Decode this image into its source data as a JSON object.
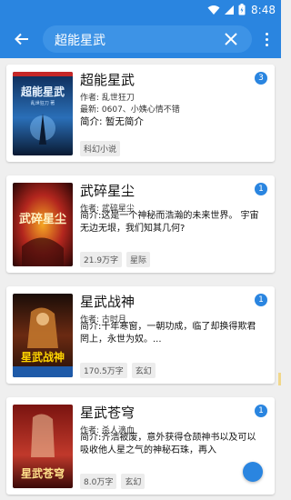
{
  "status_bar": {
    "time": "8:48",
    "icons": [
      "wifi-icon",
      "signal-icon",
      "battery-icon"
    ]
  },
  "app_bar": {
    "search_value": "超能星武",
    "icons": [
      "back-arrow-icon",
      "clear-icon",
      "more-vert-icon"
    ]
  },
  "colors": {
    "primary": "#2a85e0",
    "tag_bg": "#ececec",
    "background": "#efefef"
  },
  "results": [
    {
      "title": "超能星武",
      "author": "作者: 乱世狂刀",
      "latest": "最新: 0607、小姨心情不错",
      "intro": "简介: 暂无简介",
      "tags": [
        "科幻小说"
      ],
      "badge": "3",
      "cover_text": "超能星武",
      "cover_sub": "乱世狂刀 著"
    },
    {
      "title": "武碎星尘",
      "author": "作者: 武碎星尘",
      "intro": "简介:这是一个神秘而浩瀚的未来世界。 宇宙无边无垠，我们知其几何?",
      "tags": [
        "21.9万字",
        "星际"
      ],
      "badge": "1",
      "cover_text": "武碎星尘"
    },
    {
      "title": "星武战神",
      "author": "作者: 古时月",
      "intro": "简介:十年寒窗，一朝功成，临了却换得欺君罔上，永世为奴。...",
      "tags": [
        "170.5万字",
        "玄幻"
      ],
      "badge": "1",
      "cover_text": "星武战神"
    },
    {
      "title": "星武苍穹",
      "author": "作者: 杀人滴血",
      "intro": "简介:齐浩被废，意外获得仓颉神书以及可以吸收他人星之气的神秘石珠，再入",
      "tags": [
        "8.0万字",
        "玄幻"
      ],
      "badge": "1",
      "cover_text": "星武苍穹"
    }
  ]
}
